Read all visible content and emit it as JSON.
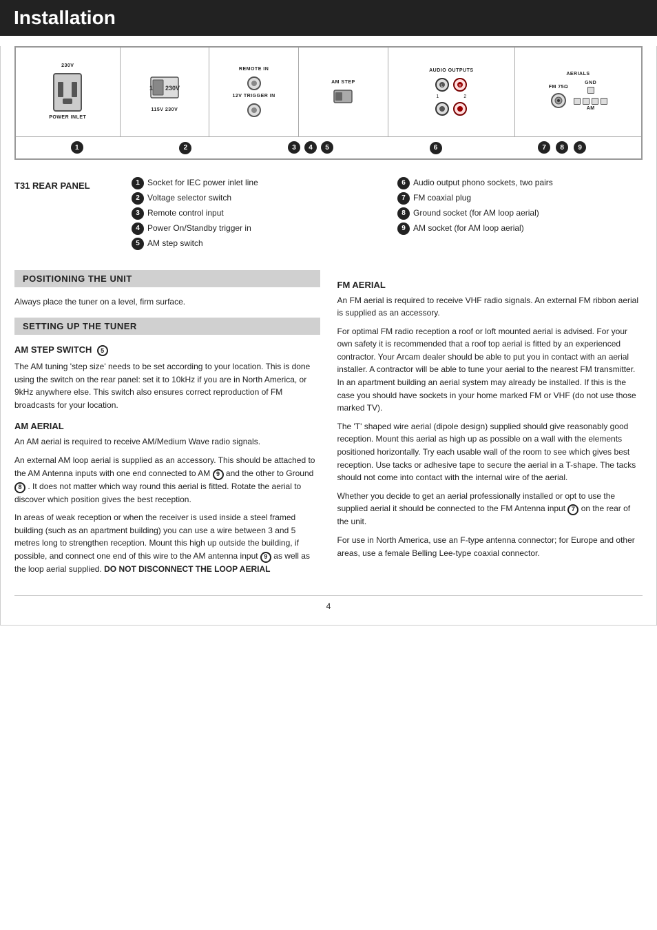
{
  "header": {
    "title": "Installation"
  },
  "diagram": {
    "alt": "T31 Rear Panel diagram"
  },
  "panel": {
    "title": "T31 REAR PANEL",
    "left_items": [
      {
        "num": "1",
        "text": "Socket for IEC power inlet line"
      },
      {
        "num": "2",
        "text": "Voltage selector switch"
      },
      {
        "num": "3",
        "text": "Remote control input"
      },
      {
        "num": "4",
        "text": "Power On/Standby trigger in"
      },
      {
        "num": "5",
        "text": "AM step switch"
      }
    ],
    "right_items": [
      {
        "num": "6",
        "text": "Audio output phono sockets, two pairs"
      },
      {
        "num": "7",
        "text": "FM coaxial plug"
      },
      {
        "num": "8",
        "text": "Ground socket (for AM loop aerial)"
      },
      {
        "num": "9",
        "text": "AM socket (for AM loop aerial)"
      }
    ]
  },
  "positioning": {
    "heading": "POSITIONING THE UNIT",
    "body": "Always place the tuner on a level, firm surface."
  },
  "setting_up": {
    "heading": "SETTING UP THE TUNER"
  },
  "am_step_switch": {
    "heading": "AM STEP SWITCH",
    "badge_num": "5",
    "body": "The AM tuning 'step size' needs to be set according to your location. This is done using the switch on the rear panel: set it to 10kHz if you are in North America, or 9kHz anywhere else. This switch also ensures correct reproduction of FM broadcasts for your location."
  },
  "am_aerial_left": {
    "heading": "AM AERIAL",
    "para1": "An AM aerial is required to receive AM/Medium Wave radio signals.",
    "para2": "An external AM loop aerial is supplied as an accessory. This should be attached to the AM Antenna inputs with one end connected to AM",
    "badge9": "9",
    "para2b": "and the other to Ground",
    "badge8": "8",
    "para2c": ". It does not matter which way round this aerial is fitted. Rotate the aerial to discover which position gives the best reception.",
    "para3": "In areas of weak reception or when the receiver is used inside a steel framed building (such as an apartment building) you can use a wire between 3 and 5 metres long to strengthen reception. Mount this high up outside the building, if possible, and connect one end of this wire to the AM antenna input",
    "badge9b": "9",
    "para3b": "as well as the loop aerial supplied.",
    "bold_end": "DO NOT DISCONNECT THE LOOP AERIAL"
  },
  "fm_aerial_right": {
    "heading": "FM AERIAL",
    "para1": "An FM aerial is required to receive VHF radio signals. An external FM ribbon aerial is supplied as an accessory.",
    "para2": "For optimal FM radio reception a roof or loft mounted aerial is advised. For your own safety it is recommended that a roof top aerial is fitted by an experienced contractor. Your Arcam dealer should be able to put you in contact with an aerial installer. A contractor will be able to tune your aerial to the nearest FM transmitter. In an apartment building an aerial system may already be installed. If this is the case you should have sockets in your home marked FM or VHF (do not use those marked TV).",
    "para3": "The 'T' shaped wire aerial (dipole design) supplied should give reasonably good reception. Mount this aerial as high up as possible on a wall with the elements positioned horizontally. Try each usable wall of the room to see which gives best reception. Use tacks or adhesive tape to secure the aerial in a T-shape. The tacks should not come into contact with the internal wire of the aerial.",
    "para4_start": "Whether you decide to get an aerial professionally installed or opt to use the supplied aerial it should be connected to the FM Antenna input",
    "badge7": "7",
    "para4_end": "on the rear of the unit.",
    "para5": "For use in North America, use an F-type antenna connector; for Europe and other areas, use a female Belling Lee-type coaxial connector."
  },
  "page_number": "4",
  "diagram_components": {
    "power_label": "POWER INLET",
    "voltage_label": "115V  230V",
    "voltage_top": "230V",
    "remote_label": "REMOTE IN",
    "trigger_label": "12V TRIGGER IN",
    "amstep_label": "AM STEP",
    "audio_label": "AUDIO OUTPUTS",
    "audio_sub1": "1",
    "audio_sub2": "2",
    "aerials_label": "AERIALS",
    "fm_label": "FM 75Ω",
    "gnd_label": "GND",
    "am_label": "AM"
  }
}
